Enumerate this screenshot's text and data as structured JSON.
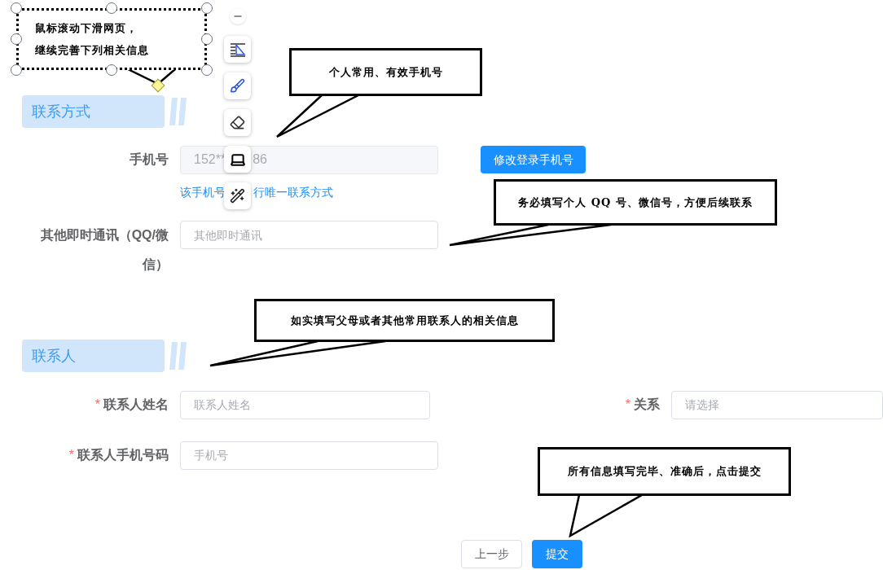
{
  "annotations": [
    {
      "lines": [
        "鼠标滚动下滑网页，",
        "继续完善下列相关信息"
      ],
      "selected": true
    },
    {
      "lines": [
        "个人常用、有效手机号"
      ],
      "selected": false
    },
    {
      "lines": [
        "务必填写个人 QQ 号、微信号，方便后续联系"
      ],
      "selected": false
    },
    {
      "lines": [
        "如实填写父母或者其他常用联系人的相关信息"
      ],
      "selected": false
    },
    {
      "lines": [
        "所有信息填写完毕、准确后，点击提交"
      ],
      "selected": false
    }
  ],
  "toolbar": [
    {
      "kind": "minus"
    },
    {
      "kind": "ruler"
    },
    {
      "kind": "brush"
    },
    {
      "kind": "eraser"
    },
    {
      "kind": "laptop"
    },
    {
      "kind": "wand"
    }
  ],
  "sections": [
    {
      "title": "联系方式",
      "rows": [
        {
          "fields": [
            {
              "label": "手机号",
              "value_parts": [
                "152**",
                "86"
              ],
              "action": "修改登录手机号",
              "hint_parts": [
                "该手机号",
                "行唯一联系方式"
              ]
            }
          ]
        },
        {
          "fields": [
            {
              "label": "其他即时通讯（QQ/微信）",
              "placeholder": "其他即时通讯"
            }
          ]
        }
      ]
    },
    {
      "title": "联系人",
      "rows": [
        {
          "fields": [
            {
              "required_mark": "*",
              "label": "联系人姓名",
              "placeholder": "联系人姓名"
            },
            {
              "required_mark": "*",
              "label": "关系",
              "placeholder": "请选择"
            }
          ]
        },
        {
          "fields": [
            {
              "required_mark": "*",
              "label": "联系人手机号码",
              "placeholder": "手机号"
            }
          ]
        }
      ]
    }
  ],
  "buttons": [
    {
      "label": "上一步",
      "primary": false
    },
    {
      "label": "提交",
      "primary": true
    }
  ]
}
